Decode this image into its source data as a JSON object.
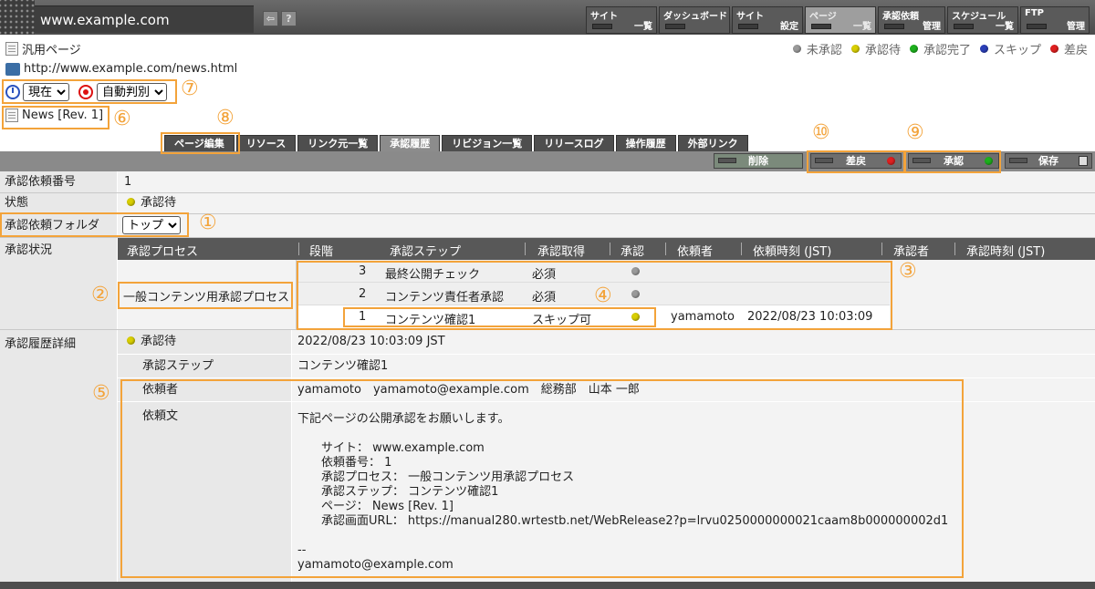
{
  "topbar": {
    "site_title": "www.example.com",
    "nav": [
      {
        "line1": "サイト",
        "line2": "一覧",
        "active": false
      },
      {
        "line1": "ダッシュボード",
        "line2": "",
        "active": false
      },
      {
        "line1": "サイト",
        "line2": "設定",
        "active": false
      },
      {
        "line1": "ページ",
        "line2": "一覧",
        "active": true
      },
      {
        "line1": "承認依頼",
        "line2": "管理",
        "active": false
      },
      {
        "line1": "スケジュール",
        "line2": "一覧",
        "active": false
      },
      {
        "line1": "FTP",
        "line2": "管理",
        "active": false
      }
    ]
  },
  "page": {
    "type_label": "汎用ページ",
    "url": "http://www.example.com/news.html",
    "time_select": "現在",
    "judge_select": "自動判別",
    "page_name": "News [Rev. 1]"
  },
  "legend": [
    {
      "label": "未承認",
      "color": "#9a9a9a"
    },
    {
      "label": "承認待",
      "color": "#d9cf00"
    },
    {
      "label": "承認完了",
      "color": "#1db11d"
    },
    {
      "label": "スキップ",
      "color": "#2b3fb8"
    },
    {
      "label": "差戻",
      "color": "#e02020"
    }
  ],
  "tabs": [
    "ページ編集",
    "リソース",
    "リンク元一覧",
    "承認履歴",
    "リビジョン一覧",
    "リリースログ",
    "操作履歴",
    "外部リンク"
  ],
  "toolbar": {
    "delete": "削除",
    "reject": "差戻",
    "approve": "承認",
    "save": "保存"
  },
  "fields": {
    "request_no_label": "承認依頼番号",
    "request_no": "1",
    "status_label": "状態",
    "status": "承認待",
    "folder_label": "承認依頼フォルダ",
    "folder": "トップ",
    "progress_label": "承認状況",
    "history_label": "承認履歴詳細"
  },
  "process_table": {
    "headers": [
      "承認プロセス",
      "段階",
      "承認ステップ",
      "承認取得",
      "承認",
      "依頼者",
      "依頼時刻 (JST)",
      "承認者",
      "承認時刻 (JST)"
    ],
    "process_name": "一般コンテンツ用承認プロセス",
    "steps": [
      {
        "stage": "3",
        "step": "最終公開チェック",
        "requirement": "必須",
        "status_color": "#9a9a9a",
        "requester": "",
        "time": ""
      },
      {
        "stage": "2",
        "step": "コンテンツ責任者承認",
        "requirement": "必須",
        "status_color": "#9a9a9a",
        "requester": "",
        "time": ""
      },
      {
        "stage": "1",
        "step": "コンテンツ確認1",
        "requirement": "スキップ可",
        "status_color": "#d9cf00",
        "requester": "yamamoto",
        "time": "2022/08/23 10:03:09"
      }
    ]
  },
  "history": {
    "status": "承認待",
    "status_time": "2022/08/23 10:03:09 JST",
    "step_label": "承認ステップ",
    "step": "コンテンツ確認1",
    "requester_label": "依頼者",
    "requester": "yamamoto　yamamoto@example.com　総務部　山本 一郎",
    "message_label": "依頼文",
    "message": "下記ページの公開承認をお願いします。\n\n　　サイト： www.example.com\n　　依頼番号： 1\n　　承認プロセス： 一般コンテンツ用承認プロセス\n　　承認ステップ： コンテンツ確認1\n　　ページ： News [Rev. 1]\n　　承認画面URL： https://manual280.wrtestb.net/WebRelease2?p=lrvu0250000000021caam8b000000002d1\n\n--\nyamamoto@example.com"
  },
  "callouts": [
    "①",
    "②",
    "③",
    "④",
    "⑤",
    "⑥",
    "⑦",
    "⑧",
    "⑨",
    "⑩"
  ]
}
